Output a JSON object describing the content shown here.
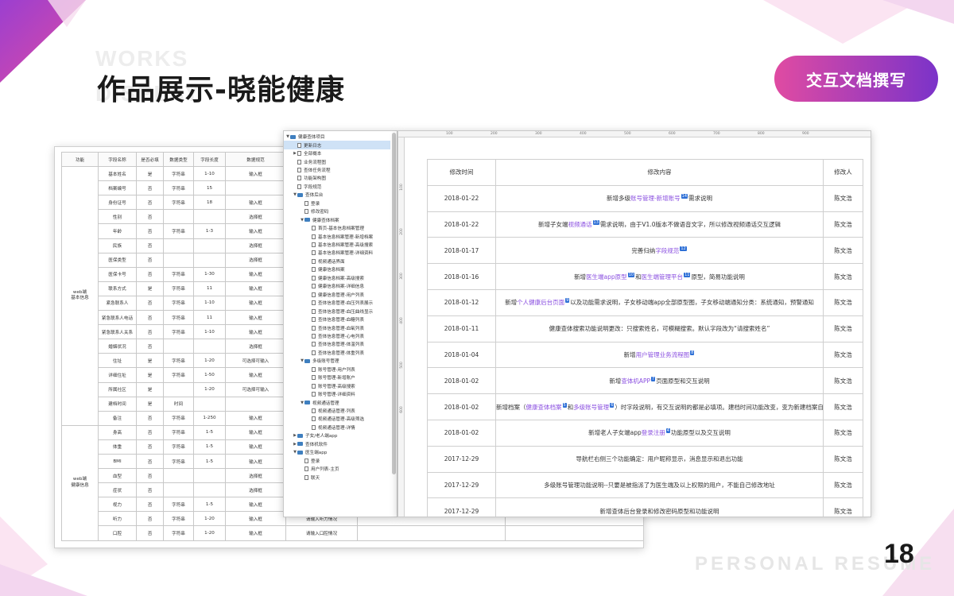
{
  "slide": {
    "title": "作品展示-晓能健康",
    "watermark_line1": "WORKS",
    "watermark_line2": "DISPLAY",
    "badge": "交互文档撰写",
    "page_number": "18",
    "footer_watermark": "PERSONAL RESUME",
    "accent_colors": [
      "#e04ba2",
      "#7b33c9"
    ]
  },
  "spec_table": {
    "headers": [
      "功能",
      "字段名称",
      "是否必填",
      "数据类型",
      "字段长度",
      "数据规范",
      "",
      ""
    ],
    "groups": [
      {
        "label_line1": "web端",
        "label_line2": "基本信息",
        "rows": [
          [
            "基本姓名",
            "是",
            "字符串",
            "1-10",
            "输入框",
            "",
            ""
          ],
          [
            "档案编号",
            "否",
            "字符串",
            "15",
            "",
            "",
            ""
          ],
          [
            "身份证号",
            "否",
            "字符串",
            "18",
            "输入框",
            "",
            ""
          ],
          [
            "性别",
            "否",
            "",
            "",
            "选择框",
            "",
            ""
          ],
          [
            "年龄",
            "否",
            "字符串",
            "1-3",
            "输入框",
            "",
            ""
          ],
          [
            "民族",
            "否",
            "",
            "",
            "选择框",
            "",
            ""
          ],
          [
            "医保类型",
            "否",
            "",
            "",
            "选择框",
            "",
            ""
          ],
          [
            "医保卡号",
            "否",
            "字符串",
            "1-30",
            "输入框",
            "",
            ""
          ],
          [
            "联系方式",
            "是",
            "字符串",
            "11",
            "输入框",
            "",
            ""
          ],
          [
            "紧急联系人",
            "否",
            "字符串",
            "1-10",
            "输入框",
            "",
            ""
          ],
          [
            "紧急联系人电话",
            "否",
            "字符串",
            "11",
            "输入框",
            "",
            ""
          ],
          [
            "紧急联系人关系",
            "否",
            "字符串",
            "1-10",
            "输入框",
            "",
            ""
          ],
          [
            "婚姻状况",
            "否",
            "",
            "",
            "选择框",
            "",
            ""
          ],
          [
            "住址",
            "是",
            "字符串",
            "1-20",
            "可选择可输入",
            "",
            ""
          ],
          [
            "详细住址",
            "是",
            "字符串",
            "1-50",
            "输入框",
            "",
            ""
          ],
          [
            "所属社区",
            "是",
            "",
            "1-20",
            "可选择可输入",
            "",
            ""
          ],
          [
            "建档时间",
            "是",
            "时间",
            "",
            "",
            "",
            ""
          ],
          [
            "备注",
            "否",
            "字符串",
            "1-250",
            "输入框",
            "",
            ""
          ]
        ]
      },
      {
        "label_line1": "web端",
        "label_line2": "健康信息",
        "rows": [
          [
            "身高",
            "否",
            "字符串",
            "1-5",
            "输入框",
            "",
            ""
          ],
          [
            "体重",
            "否",
            "字符串",
            "1-5",
            "输入框",
            "",
            ""
          ],
          [
            "BMI",
            "否",
            "字符串",
            "1-5",
            "输入框",
            "",
            ""
          ],
          [
            "血型",
            "否",
            "",
            "",
            "选择框",
            "",
            ""
          ],
          [
            "症状",
            "否",
            "",
            "",
            "选择框",
            "",
            ""
          ],
          [
            "视力",
            "否",
            "字符串",
            "1-5",
            "输入框",
            "",
            ""
          ],
          [
            "听力",
            "否",
            "字符串",
            "1-20",
            "输入框",
            "请输入听力情况",
            ""
          ],
          [
            "口腔",
            "否",
            "字符串",
            "1-20",
            "输入框",
            "请输入口腔情况",
            ""
          ]
        ]
      }
    ]
  },
  "tree": {
    "nodes": [
      {
        "text": "健康查体项目",
        "depth": 0,
        "kind": "folder",
        "arrow": "▼",
        "selected": false
      },
      {
        "text": "更新日志",
        "depth": 1,
        "kind": "page",
        "arrow": "",
        "selected": true
      },
      {
        "text": "全部概本",
        "depth": 1,
        "kind": "page",
        "arrow": "▶",
        "selected": false
      },
      {
        "text": "业务流程图",
        "depth": 1,
        "kind": "page",
        "arrow": "",
        "selected": false
      },
      {
        "text": "查体任务流程",
        "depth": 1,
        "kind": "page",
        "arrow": "",
        "selected": false
      },
      {
        "text": "功能架构图",
        "depth": 1,
        "kind": "page",
        "arrow": "",
        "selected": false
      },
      {
        "text": "字段规范",
        "depth": 1,
        "kind": "page",
        "arrow": "",
        "selected": false
      },
      {
        "text": "查体后台",
        "depth": 1,
        "kind": "folder",
        "arrow": "▼",
        "selected": false
      },
      {
        "text": "登录",
        "depth": 2,
        "kind": "page",
        "arrow": "",
        "selected": false
      },
      {
        "text": "修改密码",
        "depth": 2,
        "kind": "page",
        "arrow": "",
        "selected": false
      },
      {
        "text": "健康查体档案",
        "depth": 2,
        "kind": "folder",
        "arrow": "▼",
        "selected": false
      },
      {
        "text": "首页-基本信息档案管理",
        "depth": 3,
        "kind": "page",
        "arrow": "",
        "selected": false
      },
      {
        "text": "基本信息档案管理-新增档案",
        "depth": 3,
        "kind": "page",
        "arrow": "",
        "selected": false
      },
      {
        "text": "基本信息档案管理-高级搜索",
        "depth": 3,
        "kind": "page",
        "arrow": "",
        "selected": false
      },
      {
        "text": "基本信息档案管理-详细资料",
        "depth": 3,
        "kind": "page",
        "arrow": "",
        "selected": false
      },
      {
        "text": "视频通话界面",
        "depth": 3,
        "kind": "page",
        "arrow": "",
        "selected": false
      },
      {
        "text": "健康信息档案",
        "depth": 3,
        "kind": "page",
        "arrow": "",
        "selected": false
      },
      {
        "text": "健康信息档案-高级搜索",
        "depth": 3,
        "kind": "page",
        "arrow": "",
        "selected": false
      },
      {
        "text": "健康信息档案-详细信息",
        "depth": 3,
        "kind": "page",
        "arrow": "",
        "selected": false
      },
      {
        "text": "健康信息管理-用户列表",
        "depth": 3,
        "kind": "page",
        "arrow": "",
        "selected": false
      },
      {
        "text": "查体信息管理-血压列表展示",
        "depth": 3,
        "kind": "page",
        "arrow": "",
        "selected": false
      },
      {
        "text": "查体信息管理-血压曲线显示",
        "depth": 3,
        "kind": "page",
        "arrow": "",
        "selected": false
      },
      {
        "text": "查体信息管理-血糖列表",
        "depth": 3,
        "kind": "page",
        "arrow": "",
        "selected": false
      },
      {
        "text": "查体信息管理-血氧列表",
        "depth": 3,
        "kind": "page",
        "arrow": "",
        "selected": false
      },
      {
        "text": "查体信息管理-心电列表",
        "depth": 3,
        "kind": "page",
        "arrow": "",
        "selected": false
      },
      {
        "text": "查体信息管理-体温列表",
        "depth": 3,
        "kind": "page",
        "arrow": "",
        "selected": false
      },
      {
        "text": "查体信息管理-体重列表",
        "depth": 3,
        "kind": "page",
        "arrow": "",
        "selected": false
      },
      {
        "text": "多级账号管理",
        "depth": 2,
        "kind": "folder",
        "arrow": "▼",
        "selected": false
      },
      {
        "text": "账号管理-用户列表",
        "depth": 3,
        "kind": "page",
        "arrow": "",
        "selected": false
      },
      {
        "text": "账号管理-新增账户",
        "depth": 3,
        "kind": "page",
        "arrow": "",
        "selected": false
      },
      {
        "text": "账号管理-高级搜索",
        "depth": 3,
        "kind": "page",
        "arrow": "",
        "selected": false
      },
      {
        "text": "账号管理-详细资料",
        "depth": 3,
        "kind": "page",
        "arrow": "",
        "selected": false
      },
      {
        "text": "视频通话管理",
        "depth": 2,
        "kind": "folder",
        "arrow": "▼",
        "selected": false
      },
      {
        "text": "视频通话管理-列表",
        "depth": 3,
        "kind": "page",
        "arrow": "",
        "selected": false
      },
      {
        "text": "视频通话管理-高级筛选",
        "depth": 3,
        "kind": "page",
        "arrow": "",
        "selected": false
      },
      {
        "text": "视频通话管理-详情",
        "depth": 3,
        "kind": "page",
        "arrow": "",
        "selected": false
      },
      {
        "text": "子女/老人端app",
        "depth": 1,
        "kind": "folder",
        "arrow": "▶",
        "selected": false
      },
      {
        "text": "查体机软件",
        "depth": 1,
        "kind": "folder",
        "arrow": "▶",
        "selected": false
      },
      {
        "text": "医生端app",
        "depth": 1,
        "kind": "folder",
        "arrow": "▼",
        "selected": false
      },
      {
        "text": "登录",
        "depth": 2,
        "kind": "page",
        "arrow": "",
        "selected": false
      },
      {
        "text": "用户列表-主页",
        "depth": 2,
        "kind": "page",
        "arrow": "",
        "selected": false
      },
      {
        "text": "联天",
        "depth": 2,
        "kind": "page",
        "arrow": "",
        "selected": false
      }
    ]
  },
  "ruler": {
    "top_ticks": [
      "100",
      "200",
      "300",
      "400",
      "500",
      "600",
      "700",
      "800",
      "900"
    ],
    "left_ticks": [
      "100",
      "200",
      "300",
      "400",
      "500",
      "600"
    ]
  },
  "changelog": {
    "headers": [
      "修改时间",
      "修改内容",
      "修改人"
    ],
    "rows": [
      {
        "date": "2018-01-22",
        "parts": [
          {
            "t": "新增多级"
          },
          {
            "t": "账号管理-新增账号",
            "link": true
          },
          {
            "t": "14",
            "mark": true
          },
          {
            "t": "需求说明"
          }
        ],
        "author": "陈文浩"
      },
      {
        "date": "2018-01-22",
        "parts": [
          {
            "t": "新增子女端"
          },
          {
            "t": "视频通话",
            "link": true
          },
          {
            "t": "13",
            "mark": true
          },
          {
            "t": "需求说明，由于V1.0版本不做语音文字，所以修改视频通话交互逻辑"
          }
        ],
        "author": "陈文浩"
      },
      {
        "date": "2018-01-17",
        "parts": [
          {
            "t": "完善归纳"
          },
          {
            "t": "字段规范",
            "link": true
          },
          {
            "t": "12",
            "mark": true
          }
        ],
        "author": "陈文浩"
      },
      {
        "date": "2018-01-16",
        "parts": [
          {
            "t": "新增"
          },
          {
            "t": "医生端app原型",
            "link": true
          },
          {
            "t": "10",
            "mark": true
          },
          {
            "t": "和"
          },
          {
            "t": "医生端管理平台",
            "link": true
          },
          {
            "t": "11",
            "mark": true
          },
          {
            "t": "原型，简易功能说明"
          }
        ],
        "author": "陈文浩"
      },
      {
        "date": "2018-01-12",
        "parts": [
          {
            "t": "新增"
          },
          {
            "t": "个人健康后台页面",
            "link": true
          },
          {
            "t": "9",
            "mark": true
          },
          {
            "t": "以及功能需求说明，子女移动端app全部原型图，子女移动端通知分类：系统通知，预警通知"
          }
        ],
        "author": "陈文浩"
      },
      {
        "date": "2018-01-11",
        "parts": [
          {
            "t": "健康查体搜索功能说明更改：只搜索姓名，可模糊搜索。默认字段改为“请搜索姓名”"
          }
        ],
        "author": "陈文浩"
      },
      {
        "date": "2018-01-04",
        "parts": [
          {
            "t": "新增"
          },
          {
            "t": "用户管理业务流程图",
            "link": true
          },
          {
            "t": "8",
            "mark": true
          }
        ],
        "author": "陈文浩"
      },
      {
        "date": "2018-01-02",
        "parts": [
          {
            "t": "新增"
          },
          {
            "t": "查体机APP",
            "link": true
          },
          {
            "t": "7",
            "mark": true
          },
          {
            "t": "页面原型和交互说明"
          }
        ],
        "author": "陈文浩"
      },
      {
        "date": "2018-01-02",
        "parts": [
          {
            "t": "新增档案（"
          },
          {
            "t": "健康查体档案",
            "link": true
          },
          {
            "t": "5",
            "mark": true
          },
          {
            "t": "和"
          },
          {
            "t": "多级账号管理",
            "link": true
          },
          {
            "t": "6",
            "mark": true
          },
          {
            "t": "）时字段说明，有交互说明的都是必填项。建档时间功能改变，变为新建档案自动生成"
          }
        ],
        "author": "陈文浩"
      },
      {
        "date": "2018-01-02",
        "parts": [
          {
            "t": "新增老人子女端app"
          },
          {
            "t": "登录注册",
            "link": true
          },
          {
            "t": "4",
            "mark": true
          },
          {
            "t": "功能原型以及交互说明"
          }
        ],
        "author": "陈文浩"
      },
      {
        "date": "2017-12-29",
        "parts": [
          {
            "t": "导航栏右侧三个功能确定：用户昵称显示，消息显示和退出功能"
          }
        ],
        "author": "陈文浩"
      },
      {
        "date": "2017-12-29",
        "parts": [
          {
            "t": "多级账号管理功能说明--只要是被指派了为医生端及以上权限的用户，不能自己修改地址"
          }
        ],
        "author": "陈文浩"
      },
      {
        "date": "2017-12-29",
        "parts": [
          {
            "t": "新增查体后台登录和修改密码原型和功能说明"
          }
        ],
        "author": "陈文浩"
      }
    ]
  }
}
